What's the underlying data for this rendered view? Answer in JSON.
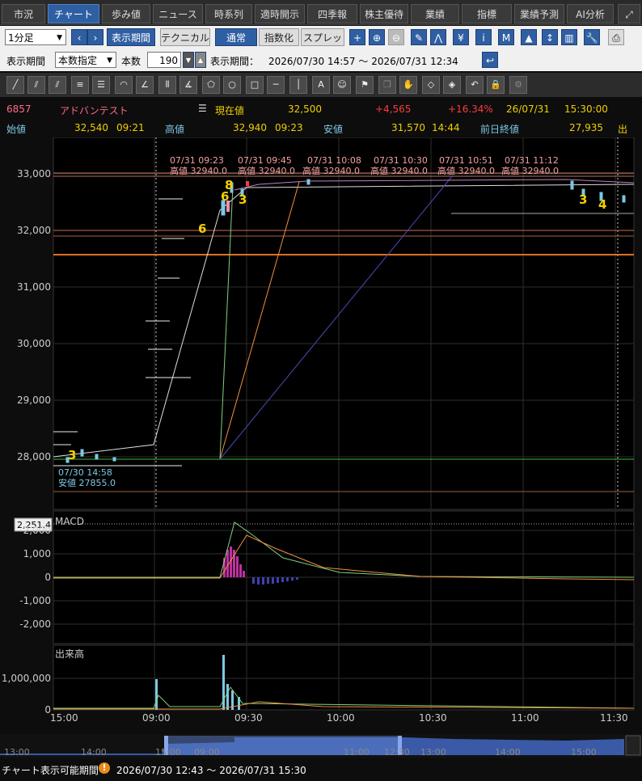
{
  "tabs": [
    "市況",
    "チャート",
    "歩み値",
    "ニュース",
    "時系列",
    "適時開示",
    "四季報",
    "株主優待",
    "業績",
    "指標",
    "業績予測",
    "AI分析"
  ],
  "toolbar": {
    "interval": "1分足",
    "display_period": "表示期間",
    "technical": "テクニカル",
    "mode_normal": "通常",
    "mode_index": "指数化",
    "mode_spread": "スプレッド"
  },
  "period": {
    "label": "表示期間",
    "type": "本数指定",
    "count_label": "本数",
    "count": "190",
    "range_label": "表示期間：",
    "range": "2026/07/30 14:57 ～ 2026/07/31 12:34"
  },
  "stock": {
    "code": "6857",
    "name": "アドバンテスト",
    "current_label": "現在値",
    "current": "32,500",
    "change": "+4,565",
    "change_pct": "+16.34%",
    "date": "26/07/31",
    "time": "15:30:00"
  },
  "ohlc": {
    "open_label": "始値",
    "open": "32,540",
    "open_time": "09:21",
    "high_label": "高値",
    "high": "32,940",
    "high_time": "09:23",
    "low_label": "安値",
    "low": "31,570",
    "low_time": "14:44",
    "prev_label": "前日終値",
    "prev": "27,935",
    "extra": "出"
  },
  "main_chart": {
    "y_ticks": [
      "33,000",
      "32,000",
      "31,000",
      "30,000",
      "29,000",
      "28,000"
    ],
    "high_annotations": [
      {
        "time": "07/31 09:23",
        "label": "高値 32940.0"
      },
      {
        "time": "07/31 09:45",
        "label": "高値 32940.0"
      },
      {
        "time": "07/31 10:08",
        "label": "高値 32940.0"
      },
      {
        "time": "07/31 10:30",
        "label": "高値 32940.0"
      },
      {
        "time": "07/31 10:51",
        "label": "高値 32940.0"
      },
      {
        "time": "07/31 11:12",
        "label": "高値 32940.0"
      }
    ],
    "low_annotation": {
      "time": "07/30 14:58",
      "label": "安値 27855.0"
    },
    "markers": [
      "3",
      "8",
      "6",
      "3",
      "6",
      "3",
      "4"
    ]
  },
  "macd": {
    "title": "MACD",
    "value_box": "2,251.4",
    "y_ticks": [
      "2,000",
      "1,000",
      "0",
      "-1,000",
      "-2,000"
    ]
  },
  "volume": {
    "title": "出来高",
    "y_ticks": [
      "1,000,000",
      "0"
    ]
  },
  "x_ticks": [
    "15:00",
    "09:00",
    "09:30",
    "10:00",
    "10:30",
    "11:00",
    "11:30"
  ],
  "nav_ticks": [
    "13:00",
    "14:00",
    "15:00",
    "09:00",
    "11:00",
    "12:30",
    "13:00",
    "14:00",
    "15:00"
  ],
  "footer": {
    "label": "チャート表示可能期間",
    "range": "2026/07/30 12:43 ～ 2026/07/31 15:30"
  },
  "colors": {
    "up": "#ff3b3b",
    "accent": "#2f5fa3",
    "label_yellow": "#f0d000",
    "cyan": "#7ec8e3"
  }
}
